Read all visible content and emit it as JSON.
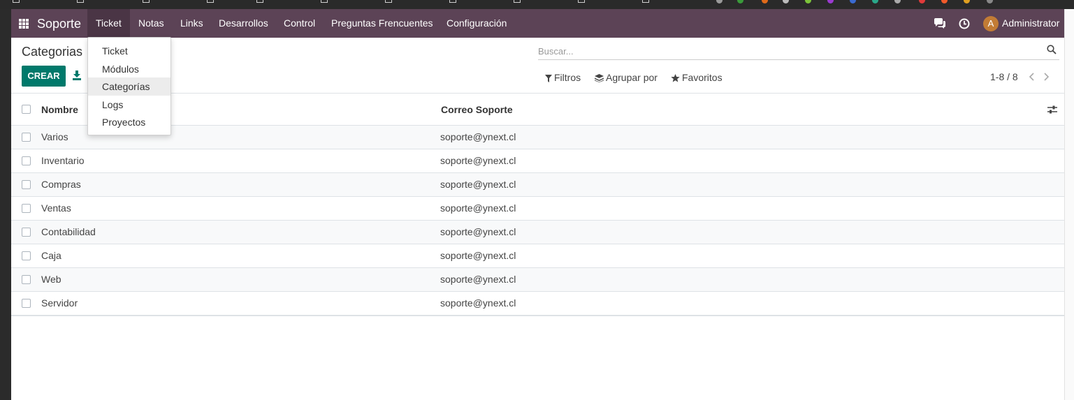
{
  "navbar": {
    "brand": "Soporte",
    "menu": [
      {
        "label": "Ticket"
      },
      {
        "label": "Notas"
      },
      {
        "label": "Links"
      },
      {
        "label": "Desarrollos"
      },
      {
        "label": "Control"
      },
      {
        "label": "Preguntas Frencuentes"
      },
      {
        "label": "Configuración"
      }
    ],
    "user": {
      "initial": "A",
      "name": "Administrator"
    },
    "icons": [
      "apps-grid-icon",
      "chat-icon",
      "clock-icon"
    ]
  },
  "dropdown": {
    "items": [
      {
        "label": "Ticket"
      },
      {
        "label": "Módulos"
      },
      {
        "label": "Categorías",
        "highlighted": true
      },
      {
        "label": "Logs"
      },
      {
        "label": "Proyectos"
      }
    ]
  },
  "control_panel": {
    "title": "Categorias",
    "create_label": "CREAR",
    "search_placeholder": "Buscar...",
    "filters_label": "Filtros",
    "group_by_label": "Agrupar por",
    "favorites_label": "Favoritos",
    "pager": "1-8 / 8"
  },
  "table": {
    "columns": [
      "Nombre",
      "Correo Soporte"
    ],
    "rows": [
      {
        "name": "Varios",
        "email": "soporte@ynext.cl"
      },
      {
        "name": "Inventario",
        "email": "soporte@ynext.cl"
      },
      {
        "name": "Compras",
        "email": "soporte@ynext.cl"
      },
      {
        "name": "Ventas",
        "email": "soporte@ynext.cl"
      },
      {
        "name": "Contabilidad",
        "email": "soporte@ynext.cl"
      },
      {
        "name": "Caja",
        "email": "soporte@ynext.cl"
      },
      {
        "name": "Web",
        "email": "soporte@ynext.cl"
      },
      {
        "name": "Servidor",
        "email": "soporte@ynext.cl"
      }
    ]
  },
  "colors": {
    "navbar": "#5c4356",
    "primary": "#00796b",
    "avatar": "#c27c35"
  }
}
